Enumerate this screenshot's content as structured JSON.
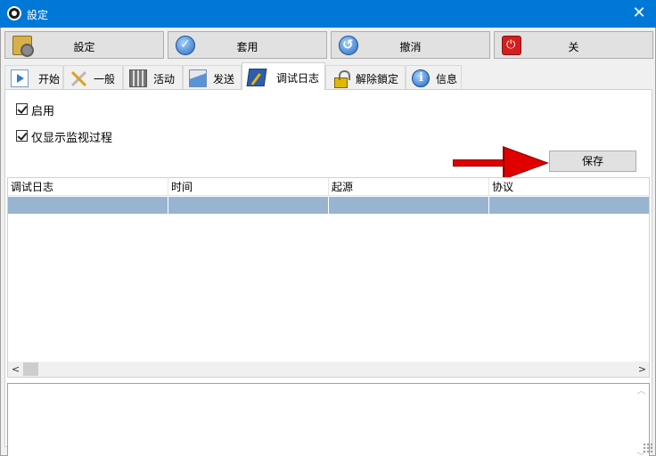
{
  "window": {
    "title": "設定",
    "close_glyph": "✕"
  },
  "toolbar": {
    "buttons": [
      {
        "label": "設定",
        "icon": "settings-icon"
      },
      {
        "label": "套用",
        "icon": "apply-check-icon"
      },
      {
        "label": "撤消",
        "icon": "undo-icon"
      },
      {
        "label": "关",
        "icon": "power-icon"
      }
    ]
  },
  "tabs": [
    {
      "label": "开始",
      "icon": "play-icon",
      "active": false
    },
    {
      "label": "一般",
      "icon": "tools-icon",
      "active": false
    },
    {
      "label": "活动",
      "icon": "activity-icon",
      "active": false
    },
    {
      "label": "发送",
      "icon": "send-icon",
      "active": false
    },
    {
      "label": "调试日志",
      "icon": "debug-log-icon",
      "active": true
    },
    {
      "label": "解除鎖定",
      "icon": "unlock-icon",
      "active": false
    },
    {
      "label": "信息",
      "icon": "info-icon",
      "active": false
    }
  ],
  "debug_log": {
    "enable_label": "启用",
    "enable_checked": true,
    "monitor_only_label": "仅显示监视过程",
    "monitor_only_checked": true,
    "save_label": "保存",
    "columns": [
      "调试日志",
      "时间",
      "起源",
      "协议"
    ],
    "selection_color": "#99b4d1",
    "arrow_color": "#e00000"
  },
  "scroll": {
    "left_glyph": "<",
    "right_glyph": ">",
    "up_glyph": "︿",
    "down_glyph": "﹀"
  }
}
